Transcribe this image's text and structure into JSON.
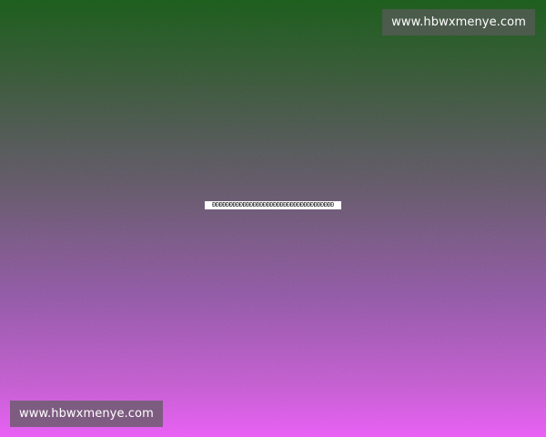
{
  "watermark_top": "www.hbwxmenye.com",
  "watermark_bottom": "www.hbwxmenye.com",
  "center_text": "ÐÐÐÐÐÐÐÐÐÐÐÐÐÐÐÐÐÐÐÐÐÐÐÐÐÐÐÐÐÐÐÐÐÐÐÐ",
  "colors": {
    "gradient_top": "#1c5a1c",
    "gradient_middle": "#66586c",
    "gradient_bottom": "#e85cf5",
    "watermark_background": "#5a5a5a",
    "watermark_text": "#ffffff",
    "center_text_background": "#ffffff"
  }
}
